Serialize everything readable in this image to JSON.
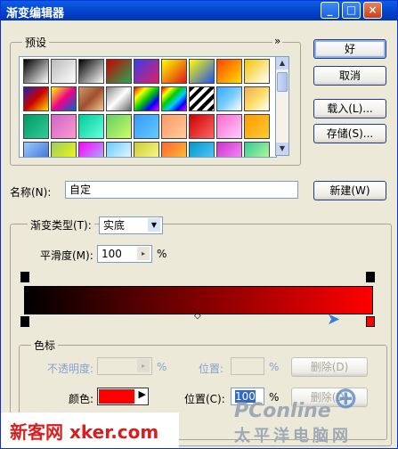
{
  "window": {
    "title": "渐变编辑器",
    "minimize": "_",
    "maximize": "□",
    "close": "×"
  },
  "presets": {
    "label": "预设",
    "menu_arrow": "»",
    "scroll_up": "▲",
    "scroll_down": "▼",
    "swatches": [
      [
        "linear-gradient(135deg,#000,#fff)",
        "linear-gradient(135deg,#bbb,#fff)",
        "linear-gradient(135deg,#000,#fff)",
        "linear-gradient(135deg,#c00,#2a5)",
        "linear-gradient(135deg,#3c3cf0,#e02060)",
        "linear-gradient(135deg,#ff0,#e01818)",
        "linear-gradient(135deg,#ff0,#2050f0)",
        "linear-gradient(135deg,#f40,#fd0)",
        "linear-gradient(135deg,#f3c400,#fff)"
      ],
      [
        "linear-gradient(135deg,#22a,#c00,#fd0)",
        "linear-gradient(135deg,#ff0,#e08,#06c)",
        "linear-gradient(135deg,#c96,#a05030,#f5c890)",
        "linear-gradient(135deg,#888,#fff,#666)",
        "linear-gradient(135deg,#e00,#ff0,#0c0,#00f,#f0f)",
        "linear-gradient(135deg,#e00,#ff0,#0c0,#0cf,#00f,#f0f)",
        "repeating-linear-gradient(135deg,#000 0 4px,#fff 4px 8px)",
        "linear-gradient(135deg,#3af,#7cf,#fff)",
        "linear-gradient(135deg,#ea5,#fd6,#fff)"
      ],
      [
        "linear-gradient(135deg,#096,#3c9)",
        "linear-gradient(135deg,#c6c,#f9c)",
        "linear-gradient(135deg,#0c9,#6fd)",
        "linear-gradient(135deg,#6c6,#cf6)",
        "linear-gradient(135deg,#39f,#6cf)",
        "linear-gradient(135deg,#f96,#fc9)",
        "linear-gradient(135deg,#c00,#f66)",
        "linear-gradient(135deg,#f6c,#fcf)",
        "linear-gradient(135deg,#f90,#fc3)"
      ],
      [
        "linear-gradient(135deg,#9cf,#36c)",
        "linear-gradient(135deg,#9c6,#ff0)",
        "linear-gradient(135deg,#f0f,#9cf)",
        "linear-gradient(135deg,#6cf,#fff)",
        "linear-gradient(135deg,#cc3,#ff9)",
        "linear-gradient(135deg,#f63,#fc3)",
        "linear-gradient(135deg,#09c,#6cf)",
        "linear-gradient(135deg,#c3c,#f9f)",
        "linear-gradient(135deg,#3c9,#cf9)"
      ]
    ]
  },
  "buttons": {
    "ok": "好",
    "cancel": "取消",
    "load": "载入(L)...",
    "save": "存储(S)...",
    "new": "新建(W)"
  },
  "name": {
    "label": "名称(N):",
    "value": "自定"
  },
  "gradient_type": {
    "label": "渐变类型(T):",
    "value": "实底"
  },
  "smoothness": {
    "label": "平滑度(M):",
    "value": "100",
    "unit": "%"
  },
  "gradient": {
    "colors": [
      "#000000",
      "#ff0000"
    ]
  },
  "color_stops": {
    "label": "色标",
    "opacity_label": "不透明度:",
    "opacity_value": "",
    "opacity_unit": "%",
    "location_label_1": "位置:",
    "location_value_1": "",
    "location_unit_1": "%",
    "delete_label_1": "删除(D)",
    "color_label": "颜色:",
    "color_value": "#ff0000",
    "location_label_2": "位置(C):",
    "location_value_2": "100",
    "location_unit_2": "%",
    "delete_label_2": "删除(D)"
  },
  "watermarks": {
    "left": "新客网 xker.com",
    "right": "PConline",
    "right_sub": "太平洋电脑网"
  }
}
